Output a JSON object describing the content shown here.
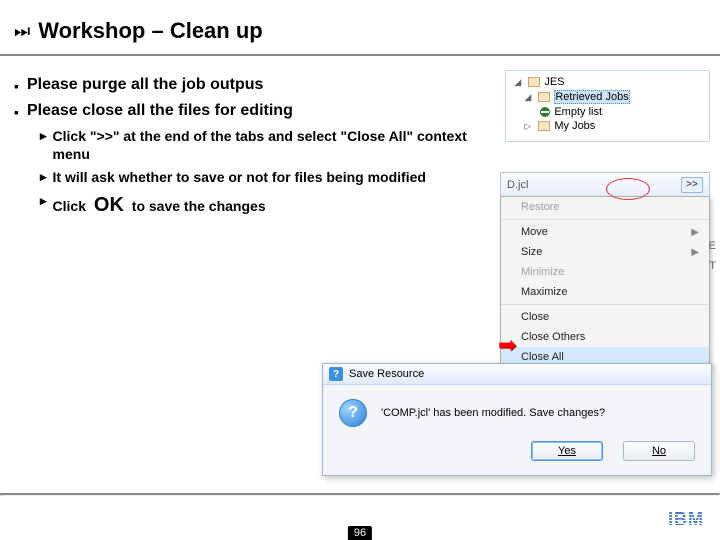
{
  "title": "Workshop – Clean up",
  "bullets": {
    "b1": "Please purge all the job outpus",
    "b2": "Please close all the files for editing",
    "s1": "Click \">>\" at the end of the tabs and select \"Close All\" context menu",
    "s2": "It will ask whether to save or not for files being modified",
    "s3a": "Click ",
    "s3ok": "OK",
    "s3b": " to save the changes"
  },
  "tree": {
    "root": "JES",
    "retrieved": "Retrieved Jobs",
    "empty": "Empty list",
    "myjobs": "My Jobs"
  },
  "tabbar": {
    "chev": ">>",
    "frag": "D.jcl"
  },
  "ctx": {
    "restore": "Restore",
    "move": "Move",
    "size": "Size",
    "min": "Minimize",
    "max": "Maximize",
    "close": "Close",
    "closeothers": "Close Others",
    "closeall": "Close All"
  },
  "side": {
    "e": "E",
    "t": "T"
  },
  "dialog": {
    "title": "Save Resource",
    "msg": "'COMP.jcl' has been modified. Save changes?",
    "yes": "Yes",
    "no": "No"
  },
  "footer": {
    "page": "96",
    "logo": "IBM"
  }
}
